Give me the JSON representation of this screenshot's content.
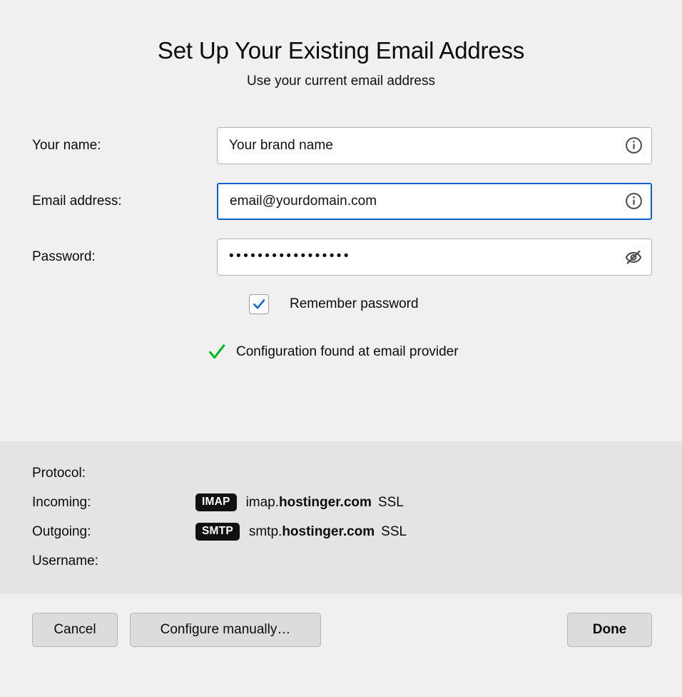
{
  "header": {
    "title": "Set Up Your Existing Email Address",
    "subtitle": "Use your current email address"
  },
  "form": {
    "name": {
      "label": "Your name:",
      "value": "Your brand name",
      "icon": "info-icon"
    },
    "email": {
      "label": "Email address:",
      "value": "email@yourdomain.com",
      "icon": "info-icon",
      "focused": true,
      "focus_color": "#0b62cd"
    },
    "password": {
      "label": "Password:",
      "value": "•••••••••••••••••",
      "masked_char_count": 17,
      "icon": "eye-slash-icon"
    },
    "remember": {
      "label": "Remember password",
      "checked": true,
      "check_color": "#0a62d6"
    },
    "status": {
      "text": "Configuration found at email provider",
      "icon": "green-check-icon",
      "color": "#00bb22"
    }
  },
  "details": {
    "protocol": {
      "label": "Protocol:",
      "value": ""
    },
    "incoming": {
      "label": "Incoming:",
      "badge": "IMAP",
      "host_prefix": "imap.",
      "host_domain": "hostinger.com",
      "security": "SSL"
    },
    "outgoing": {
      "label": "Outgoing:",
      "badge": "SMTP",
      "host_prefix": "smtp.",
      "host_domain": "hostinger.com",
      "security": "SSL"
    },
    "username": {
      "label": "Username:",
      "value": "testingaccount@hostinger-dev-31.x"
    }
  },
  "footer": {
    "cancel": "Cancel",
    "configure_manually": "Configure manually…",
    "done": "Done"
  }
}
